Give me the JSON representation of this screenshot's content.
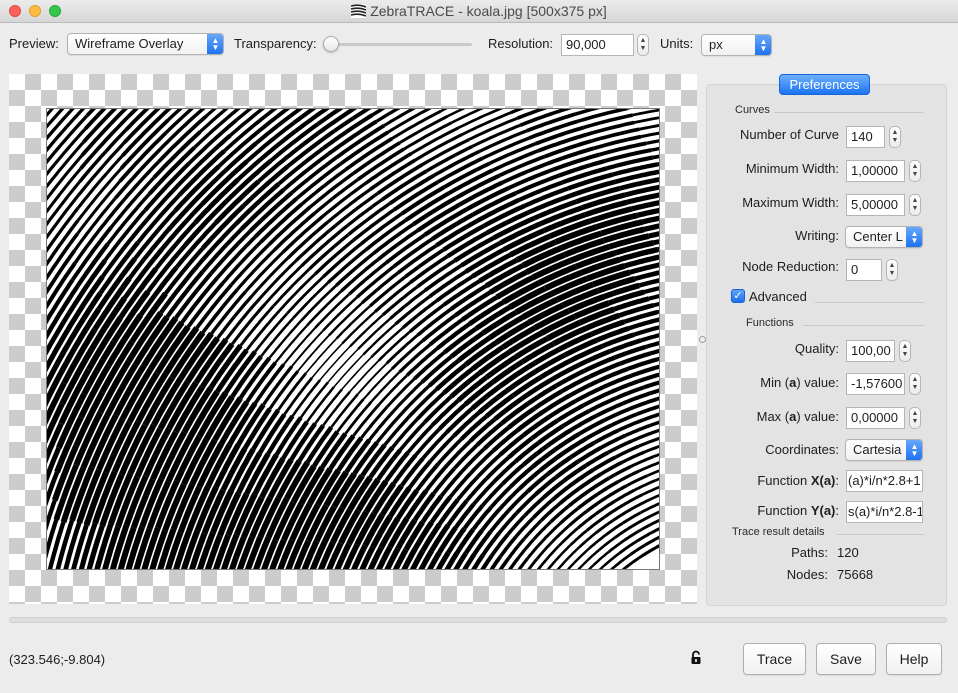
{
  "window": {
    "title": "ZebraTRACE - koala.jpg [500x375 px]"
  },
  "toolbar": {
    "preview_label": "Preview:",
    "preview_value": "Wireframe Overlay",
    "transparency_label": "Transparency:",
    "transparency_level": 0,
    "resolution_label": "Resolution:",
    "resolution_value": "90,000",
    "units_label": "Units:",
    "units_value": "px"
  },
  "preferences": {
    "tab_label": "Preferences",
    "curves_section": "Curves",
    "number_of_curves_label": "Number of Curve",
    "number_of_curves_value": "140",
    "min_width_label": "Minimum Width:",
    "min_width_value": "1,00000",
    "max_width_label": "Maximum Width:",
    "max_width_value": "5,00000",
    "writing_label": "Writing:",
    "writing_value": "Center L",
    "node_reduction_label": "Node Reduction:",
    "node_reduction_value": "0",
    "advanced_label": "Advanced",
    "advanced_checked": true,
    "functions_section": "Functions",
    "quality_label": "Quality:",
    "quality_value": "100,00",
    "min_a_label_pre": "Min (",
    "min_a_label_var": "a",
    "min_a_label_post": ") value:",
    "min_a_value": "-1,57600",
    "max_a_label_pre": "Max (",
    "max_a_label_var": "a",
    "max_a_label_post": ") value:",
    "max_a_value": "0,00000",
    "coordinates_label": "Coordinates:",
    "coordinates_value": "Cartesia",
    "function_x_label_pre": "Function ",
    "function_x_label_bold": "X(a)",
    "function_x_label_post": ":",
    "function_x_value": "(a)*i/n*2.8+1",
    "function_y_label_pre": "Function ",
    "function_y_label_bold": "Y(a)",
    "function_y_label_post": ":",
    "function_y_value": "s(a)*i/n*2.8-1",
    "trace_section": "Trace result details",
    "paths_label": "Paths:",
    "paths_value": "120",
    "nodes_label": "Nodes:",
    "nodes_value": "75668"
  },
  "status": {
    "coordinates": "(323.546;-9.804)"
  },
  "buttons": {
    "trace": "Trace",
    "save": "Save",
    "help": "Help"
  }
}
